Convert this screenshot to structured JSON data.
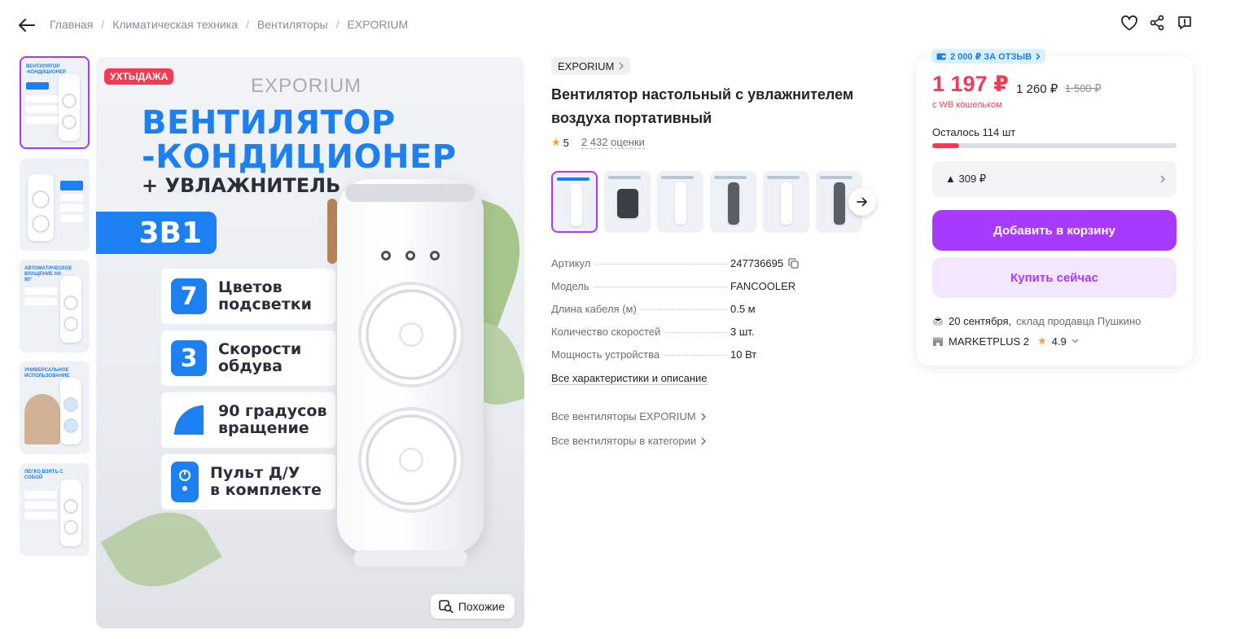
{
  "colors": {
    "accent": "#a73afd",
    "price_red": "#f43a55",
    "promo_blue": "#1c7ff2",
    "rating_star": "#ff9e2c"
  },
  "breadcrumbs": [
    "Главная",
    "Климатическая техника",
    "Вентиляторы",
    "EXPORIUM"
  ],
  "top_actions": {
    "icons": [
      "heart-icon",
      "share-icon",
      "report-icon"
    ]
  },
  "gallery": {
    "thumbnails": [
      {
        "caption": "ВЕНТИЛЯТОР -КОНДИЦИОНЕР"
      },
      {
        "caption": ""
      },
      {
        "caption": "АВТОМАТИЧЕСКОЕ ВРАЩЕНИЕ НА 90°"
      },
      {
        "caption": "УНИВЕРСАЛЬНОЕ ИСПОЛЬЗОВАНИЕ"
      },
      {
        "caption": "ЛЕГКО ВЗЯТЬ С СОБОЙ"
      }
    ],
    "main": {
      "promo_badge": "УХТЫДАЖА",
      "brand": "EXPORIUM",
      "headline_1": "ВЕНТИЛЯТОР",
      "headline_2": "-КОНДИЦИОНЕР",
      "subline": "+ УВЛАЖНИТЕЛЬ",
      "combo": "3В1",
      "features": [
        {
          "num": "7",
          "text": "Цветов\nподсветки"
        },
        {
          "num": "3",
          "text": "Скорости\nобдува"
        },
        {
          "num": "",
          "text": "90 градусов\nвращение"
        },
        {
          "num": "",
          "text": "Пульт Д/У\nв комплекте"
        }
      ]
    },
    "similar_label": "Похожие"
  },
  "product": {
    "brand": "EXPORIUM",
    "title": "Вентилятор настольный с увлажнителем воздуха портативный",
    "rating": "5",
    "reviews": "2 432 оценки"
  },
  "specs": [
    {
      "key": "Артикул",
      "value": "247736695"
    },
    {
      "key": "Модель",
      "value": "FANCOOLER"
    },
    {
      "key": "Длина кабеля (м)",
      "value": "0.5 м"
    },
    {
      "key": "Количество скоростей",
      "value": "3 шт."
    },
    {
      "key": "Мощность устройства",
      "value": "10 Вт"
    }
  ],
  "links": {
    "all_specs": "Все характеристики и описание",
    "brand_category": "Все вентиляторы EXPORIUM",
    "category": "Все вентиляторы в категории"
  },
  "price_card": {
    "review_bonus": "2 000 ₽ ЗА ОТЗЫВ",
    "price_main": "1 197 ₽",
    "price_wallet": "1 260 ₽",
    "price_old": "1 500 ₽",
    "price_note": "с WB кошельком",
    "stock_text": "Осталось 114 шт",
    "stock_fraction": 0.11,
    "installment": "▲ 309 ₽",
    "add_to_cart": "Добавить в корзину",
    "buy_now": "Купить сейчас",
    "delivery_date": "20 сентября,",
    "delivery_place": "склад продавца Пушкино",
    "seller_name": "MARKETPLUS 2",
    "seller_rating": "4.9"
  }
}
